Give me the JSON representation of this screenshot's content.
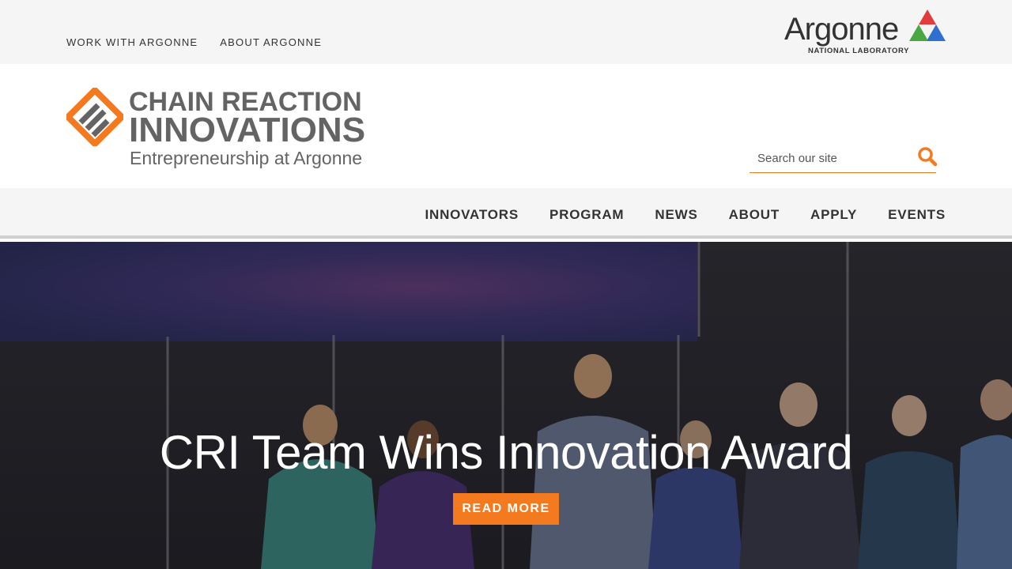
{
  "utility": {
    "links": [
      "WORK WITH ARGONNE",
      "ABOUT ARGONNE"
    ],
    "argonne_logo": {
      "wordmark": "Argonne",
      "subtitle": "NATIONAL LABORATORY"
    }
  },
  "header": {
    "logo": {
      "line1": "CHAIN REACTION",
      "line2": "INNOVATIONS",
      "line3": "Entrepreneurship at Argonne"
    },
    "search": {
      "placeholder": "Search our site",
      "icon": "search-icon"
    }
  },
  "nav": {
    "items": [
      "INNOVATORS",
      "PROGRAM",
      "NEWS",
      "ABOUT",
      "APPLY",
      "EVENTS"
    ]
  },
  "hero": {
    "title": "CRI Team Wins Innovation Award",
    "button": "READ MORE"
  },
  "colors": {
    "accent": "#f47a20",
    "text": "#333333",
    "logo_gray": "#646464",
    "bar_bg": "#f5f5f5"
  }
}
